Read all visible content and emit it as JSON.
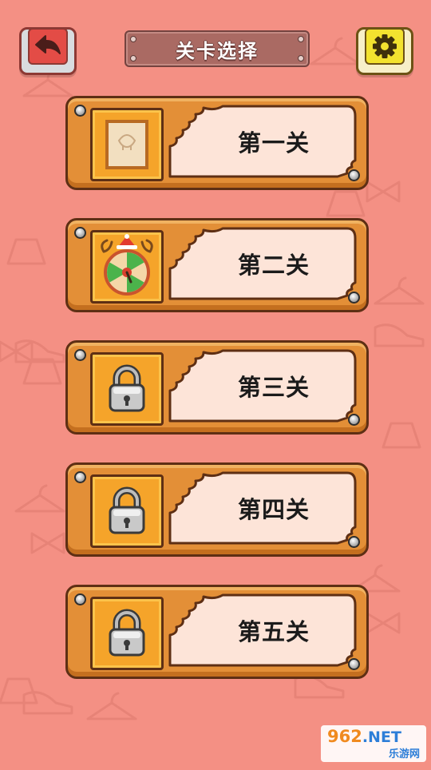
{
  "header": {
    "title": "关卡选择",
    "back_icon": "back-arrow-icon",
    "settings_icon": "gear-icon"
  },
  "levels": [
    {
      "label": "第一关",
      "locked": false,
      "thumbnail": "picture-frame-icon"
    },
    {
      "label": "第二关",
      "locked": false,
      "thumbnail": "reindeer-wheel-icon"
    },
    {
      "label": "第三关",
      "locked": true,
      "thumbnail": "padlock-icon"
    },
    {
      "label": "第四关",
      "locked": true,
      "thumbnail": "padlock-icon"
    },
    {
      "label": "第五关",
      "locked": true,
      "thumbnail": "padlock-icon"
    }
  ],
  "watermark": {
    "brand": "962",
    "domain": ".NET",
    "sub": "乐游网"
  },
  "colors": {
    "background": "#f49084",
    "card": "#e38f37",
    "card_border": "#5e2f14",
    "label_panel": "#fde4d8",
    "back_button": "#e34c46",
    "settings_button": "#f3e22f"
  }
}
